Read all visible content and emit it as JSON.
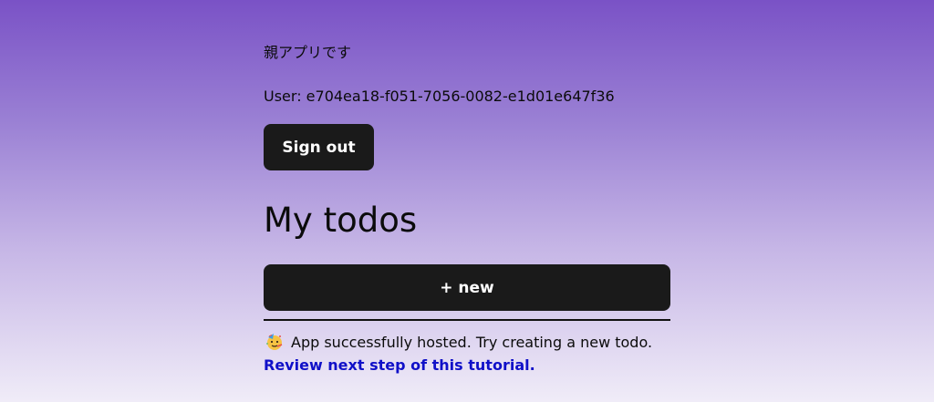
{
  "app": {
    "parent_label": "親アプリです",
    "user_line": "User: e704ea18-f051-7056-0082-e1d01e647f36",
    "sign_out_label": "Sign out"
  },
  "todos": {
    "title": "My todos",
    "new_button_label": "+ new",
    "items": []
  },
  "message": {
    "icon": "party-face-icon",
    "text": "App successfully hosted. Try creating a new todo.",
    "link_text": "Review next step of this tutorial."
  },
  "colors": {
    "gradient_top": "#7a52c6",
    "gradient_bottom": "#f0ecf8",
    "button_bg": "#1a1a1a",
    "link": "#1010c8"
  }
}
